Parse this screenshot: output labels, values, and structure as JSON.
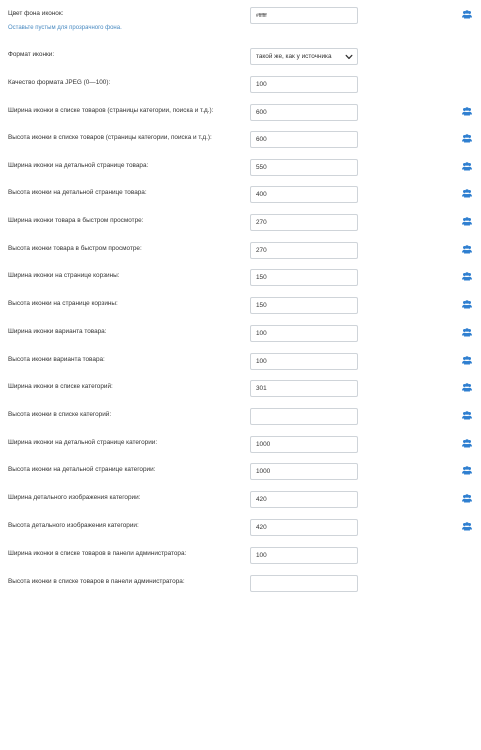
{
  "accent_color": "#2f7fd0",
  "icon_name": "users-icon",
  "bg_color_field": {
    "label": "Цвет фона иконок:",
    "hint": "Оставьте пустым для прозрачного фона.",
    "value": "#ffffff"
  },
  "format_field": {
    "label": "Формат иконки:",
    "value": "такой же, как у источника"
  },
  "quality_field": {
    "label": "Качество формата JPEG (0—100):",
    "value": "100"
  },
  "fields": [
    {
      "label": "Ширина иконки в списке товаров (страницы категории, поиска и т.д.):",
      "value": "600"
    },
    {
      "label": "Высота иконки в списке товаров (страницы категории, поиска и т.д.):",
      "value": "600"
    },
    {
      "label": "Ширина иконки на детальной странице товара:",
      "value": "550"
    },
    {
      "label": "Высота иконки на детальной странице товара:",
      "value": "400"
    },
    {
      "label": "Ширина иконки товара в быстром просмотре:",
      "value": "270"
    },
    {
      "label": "Высота иконки товара в быстром просмотре:",
      "value": "270"
    },
    {
      "label": "Ширина иконки на странице корзины:",
      "value": "150"
    },
    {
      "label": "Высота иконки на странице корзины:",
      "value": "150"
    },
    {
      "label": "Ширина иконки варианта товара:",
      "value": "100"
    },
    {
      "label": "Высота иконки варианта товара:",
      "value": "100"
    },
    {
      "label": "Ширина иконки в списке категорий:",
      "value": "301"
    },
    {
      "label": "Высота иконки в списке категорий:",
      "value": ""
    },
    {
      "label": "Ширина иконки на детальной странице категории:",
      "value": "1000"
    },
    {
      "label": "Высота иконки на детальной странице категории:",
      "value": "1000"
    },
    {
      "label": "Ширина детального изображения категории:",
      "value": "420"
    },
    {
      "label": "Высота детального изображения категории:",
      "value": "420"
    },
    {
      "label": "Ширина иконки в списке товаров в панели администратора:",
      "value": "100"
    },
    {
      "label": "Высота иконки в списке товаров в панели администратора:",
      "value": ""
    }
  ]
}
